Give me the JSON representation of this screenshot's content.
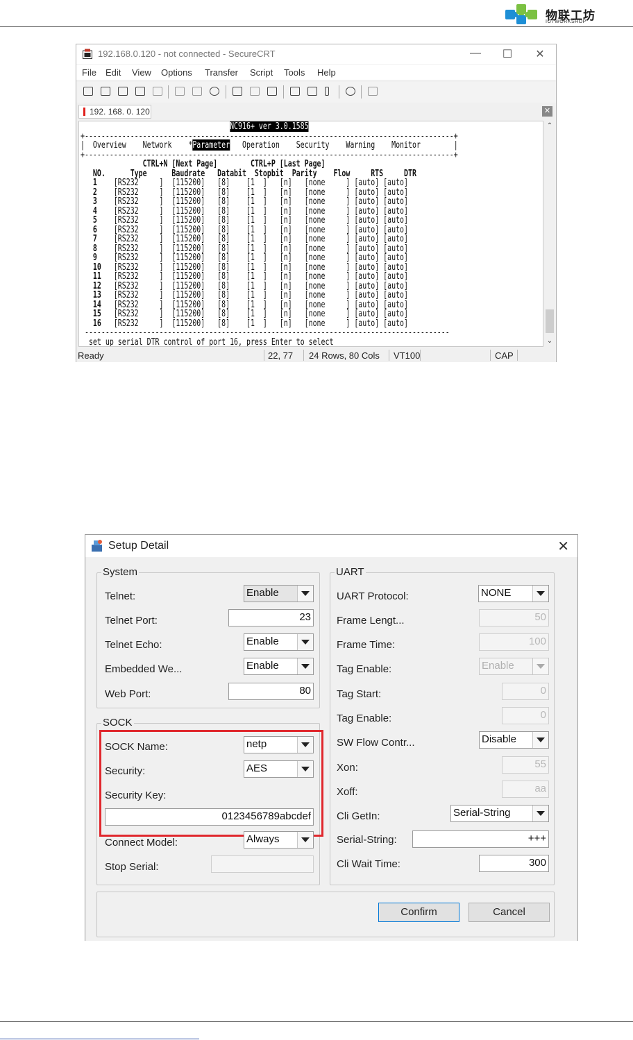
{
  "logo": {
    "cn": "物联工坊",
    "en": "IOTWORKSHOP"
  },
  "crt": {
    "title": "192.168.0.120 - not connected - SecureCRT",
    "window_buttons": [
      "—",
      "☐",
      "✕"
    ],
    "menu": [
      "File",
      "Edit",
      "View",
      "Options",
      "Transfer",
      "Script",
      "Tools",
      "Help"
    ],
    "tab_label": "192. 168. 0. 120",
    "tab_close": "✕",
    "terminal": {
      "version": "NC916+ ver 3.0.1585",
      "nav_items": [
        "Overview",
        "Network",
        "Parameter",
        "Operation",
        "Security",
        "Warning",
        "Monitor"
      ],
      "selected_nav": "Parameter",
      "next_page": "CTRL+N [Next Page]",
      "last_page": "CTRL+P [Last Page]",
      "columns": [
        "NO.",
        "Type",
        "Baudrate",
        "Databit",
        "Stopbit",
        "Parity",
        "Flow",
        "RTS",
        "DTR"
      ],
      "rows": [
        [
          "1",
          "RS232",
          "115200",
          "8",
          "1",
          "n",
          "none",
          "auto",
          "auto"
        ],
        [
          "2",
          "RS232",
          "115200",
          "8",
          "1",
          "n",
          "none",
          "auto",
          "auto"
        ],
        [
          "3",
          "RS232",
          "115200",
          "8",
          "1",
          "n",
          "none",
          "auto",
          "auto"
        ],
        [
          "4",
          "RS232",
          "115200",
          "8",
          "1",
          "n",
          "none",
          "auto",
          "auto"
        ],
        [
          "5",
          "RS232",
          "115200",
          "8",
          "1",
          "n",
          "none",
          "auto",
          "auto"
        ],
        [
          "6",
          "RS232",
          "115200",
          "8",
          "1",
          "n",
          "none",
          "auto",
          "auto"
        ],
        [
          "7",
          "RS232",
          "115200",
          "8",
          "1",
          "n",
          "none",
          "auto",
          "auto"
        ],
        [
          "8",
          "RS232",
          "115200",
          "8",
          "1",
          "n",
          "none",
          "auto",
          "auto"
        ],
        [
          "9",
          "RS232",
          "115200",
          "8",
          "1",
          "n",
          "none",
          "auto",
          "auto"
        ],
        [
          "10",
          "RS232",
          "115200",
          "8",
          "1",
          "n",
          "none",
          "auto",
          "auto"
        ],
        [
          "11",
          "RS232",
          "115200",
          "8",
          "1",
          "n",
          "none",
          "auto",
          "auto"
        ],
        [
          "12",
          "RS232",
          "115200",
          "8",
          "1",
          "n",
          "none",
          "auto",
          "auto"
        ],
        [
          "13",
          "RS232",
          "115200",
          "8",
          "1",
          "n",
          "none",
          "auto",
          "auto"
        ],
        [
          "14",
          "RS232",
          "115200",
          "8",
          "1",
          "n",
          "none",
          "auto",
          "auto"
        ],
        [
          "15",
          "RS232",
          "115200",
          "8",
          "1",
          "n",
          "none",
          "auto",
          "auto"
        ],
        [
          "16",
          "RS232",
          "115200",
          "8",
          "1",
          "n",
          "none",
          "auto",
          "auto"
        ]
      ],
      "message": "set up serial DTR control of port 16, press Enter to select"
    },
    "status": {
      "ready": "Ready",
      "cursor": "22,  77",
      "size": "24 Rows,  80 Cols",
      "emulation": "VT100",
      "caps": "CAP"
    }
  },
  "dialog": {
    "title": "Setup Detail",
    "close": "✕",
    "system": {
      "label": "System",
      "telnet_label": "Telnet:",
      "telnet_value": "Enable",
      "telnet_port_label": "Telnet Port:",
      "telnet_port_value": "23",
      "telnet_echo_label": "Telnet Echo:",
      "telnet_echo_value": "Enable",
      "embedded_web_label": "Embedded We...",
      "embedded_web_value": "Enable",
      "web_port_label": "Web Port:",
      "web_port_value": "80"
    },
    "sock": {
      "label": "SOCK",
      "sock_name_label": "SOCK Name:",
      "sock_name_value": "netp",
      "security_label": "Security:",
      "security_value": "AES",
      "security_key_label": "Security Key:",
      "security_key_value": "0123456789abcdef",
      "connect_model_label": "Connect Model:",
      "connect_model_value": "Always",
      "stop_serial_label": "Stop Serial:",
      "stop_serial_value": ""
    },
    "uart": {
      "label": "UART",
      "protocol_label": "UART Protocol:",
      "protocol_value": "NONE",
      "frame_length_label": "Frame Lengt...",
      "frame_length_value": "50",
      "frame_time_label": "Frame Time:",
      "frame_time_value": "100",
      "tag_enable_label": "Tag Enable:",
      "tag_enable_value": "Enable",
      "tag_start_label": "Tag Start:",
      "tag_start_value": "0",
      "tag_enable2_label": "Tag Enable:",
      "tag_enable2_value": "0",
      "sw_flow_label": "SW Flow Contr...",
      "sw_flow_value": "Disable",
      "xon_label": "Xon:",
      "xon_value": "55",
      "xoff_label": "Xoff:",
      "xoff_value": "aa",
      "cli_getin_label": "Cli GetIn:",
      "cli_getin_value": "Serial-String",
      "serial_string_label": "Serial-String:",
      "serial_string_value": "+++",
      "cli_wait_label": "Cli Wait Time:",
      "cli_wait_value": "300"
    },
    "confirm_label": "Confirm",
    "cancel_label": "Cancel"
  },
  "colors": {
    "highlight": "#e0282e",
    "logo_blue": "#1e8fd6",
    "logo_green": "#7bc142",
    "selection": "#000000"
  }
}
